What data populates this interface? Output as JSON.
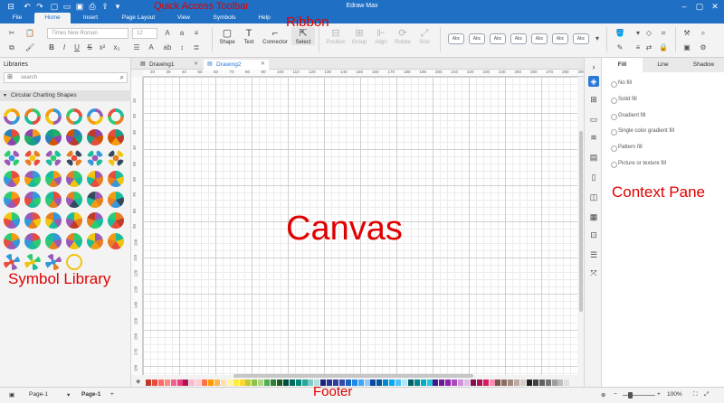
{
  "app_title": "Edraw Max",
  "menu": [
    "File",
    "Home",
    "Insert",
    "Page Layout",
    "View",
    "Symbols",
    "Help"
  ],
  "ribbon": {
    "font_name": "Times New Roman",
    "font_size": "12",
    "tools": [
      "Shape",
      "Text",
      "Connector",
      "Select"
    ],
    "disabled_tools": [
      "Position",
      "Group",
      "Align",
      "Rotate",
      "Size"
    ],
    "style_label": "Abc"
  },
  "library": {
    "header": "Libraries",
    "search_placeholder": "search",
    "category": "Circular Charting Shapes"
  },
  "doc_tabs": [
    "Drawing1",
    "Drawing2"
  ],
  "ruler_top": [
    "20",
    "30",
    "40",
    "50",
    "60",
    "70",
    "80",
    "90",
    "100",
    "110",
    "120",
    "130",
    "140",
    "150",
    "160",
    "170",
    "180",
    "190",
    "200",
    "210",
    "220",
    "230",
    "240",
    "250",
    "260",
    "270",
    "280",
    "290"
  ],
  "ruler_left": [
    "10",
    "20",
    "30",
    "40",
    "50",
    "60",
    "70",
    "80",
    "90",
    "100",
    "110",
    "120",
    "130",
    "140",
    "150",
    "160",
    "170",
    "180",
    "190"
  ],
  "pane": {
    "tabs": [
      "Fill",
      "Line",
      "Shadow"
    ],
    "fill_options": [
      "No fill",
      "Solid fill",
      "Gradient fill",
      "Single color gradient fill",
      "Pattern fill",
      "Picture or texture fill"
    ]
  },
  "footer": {
    "page_dropdown": "Page-1",
    "page_tab": "Page-1",
    "add": "+",
    "zoom": "100%"
  },
  "annotations": {
    "qat": "Quick Access Toolbar",
    "ribbon": "Ribbon",
    "canvas": "Canvas",
    "symbol_library": "Symbol Library",
    "context_pane": "Context Pane",
    "footer": "Footer"
  },
  "palette_colors": [
    "#c0392b",
    "#e74c3c",
    "#ff6b6b",
    "#ff8a80",
    "#f06292",
    "#ec407a",
    "#ad1457",
    "#f8bbd0",
    "#ffcdd2",
    "#ff7043",
    "#ff9800",
    "#ffb74d",
    "#ffe0b2",
    "#fff59d",
    "#ffeb3b",
    "#fdd835",
    "#c0ca33",
    "#8bc34a",
    "#aed581",
    "#4caf50",
    "#2e7d32",
    "#1b5e20",
    "#004d40",
    "#00695c",
    "#00897b",
    "#26a69a",
    "#80cbc4",
    "#b2dfdb",
    "#1a237e",
    "#283593",
    "#303f9f",
    "#3949ab",
    "#1565c0",
    "#1e88e5",
    "#42a5f5",
    "#90caf9",
    "#0d47a1",
    "#01579b",
    "#0288d1",
    "#03a9f4",
    "#4fc3f7",
    "#b3e5fc",
    "#006064",
    "#00838f",
    "#00acc1",
    "#26c6da",
    "#4a148c",
    "#6a1b9a",
    "#8e24aa",
    "#ab47bc",
    "#ce93d8",
    "#e1bee7",
    "#880e4f",
    "#ad1457",
    "#d81b60",
    "#f48fb1",
    "#795548",
    "#8d6e63",
    "#a1887f",
    "#bcaaa4",
    "#d7ccc8",
    "#212121",
    "#424242",
    "#616161",
    "#757575",
    "#9e9e9e",
    "#bdbdbd",
    "#e0e0e0"
  ],
  "symbol_colors": [
    [
      "#f39c12",
      "#2ecc71",
      "#3498db",
      "#e74c3c",
      "#9b59b6",
      "#1abc9c",
      "#f1c40f",
      "#e67e22"
    ],
    [
      "#e74c3c",
      "#f39c12",
      "#27ae60",
      "#2980b9",
      "#8e44ad",
      "#16a085",
      "#d35400",
      "#c0392b"
    ],
    [
      "#3498db",
      "#f1c40f",
      "#2ecc71",
      "#e74c3c",
      "#9b59b6",
      "#e67e22",
      "#1abc9c",
      "#34495e"
    ],
    [
      "#e74c3c",
      "#3498db",
      "#f39c12",
      "#2ecc71",
      "#9b59b6",
      "#1abc9c",
      "#e67e22",
      "#f1c40f"
    ],
    [
      "#f39c12",
      "#3498db",
      "#e74c3c",
      "#2ecc71",
      "#9b59b6",
      "#1abc9c",
      "#e67e22",
      "#34495e"
    ],
    [
      "#2ecc71",
      "#e74c3c",
      "#3498db",
      "#f1c40f",
      "#9b59b6",
      "#e67e22",
      "#1abc9c",
      "#c0392b"
    ],
    [
      "#f39c12",
      "#e74c3c",
      "#3498db",
      "#2ecc71",
      "#9b59b6",
      "#1abc9c",
      "#e67e22",
      "#f1c40f"
    ],
    [
      "#e74c3c",
      "#f1c40f",
      "#3498db",
      "#2ecc71",
      "#9b59b6",
      "#1abc9c",
      "#e67e22",
      "#34495e"
    ]
  ]
}
